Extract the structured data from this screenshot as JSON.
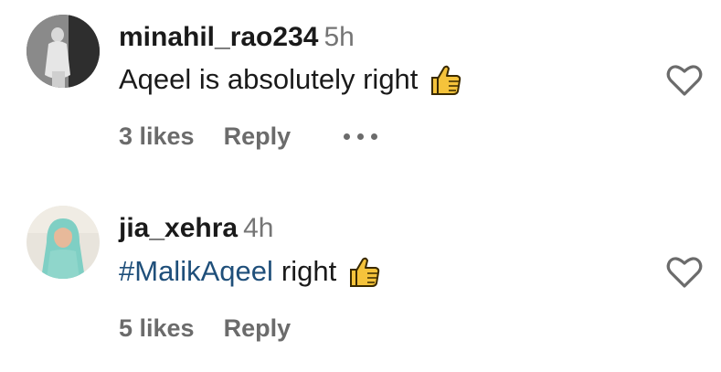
{
  "comments": [
    {
      "username": "minahil_rao234",
      "time": "5h",
      "text": "Aqeel is absolutely right",
      "hashtag": "",
      "emoji": "thumbs-up",
      "likes": "3 likes",
      "reply": "Reply",
      "avatar": "avatar-grayscale-photo",
      "more_icon": "more-horizontal-icon",
      "like_icon": "heart-outline-icon"
    },
    {
      "username": "jia_xehra",
      "time": "4h",
      "text": "right",
      "hashtag": "#MalikAqeel",
      "emoji": "thumbs-up",
      "likes": "5 likes",
      "reply": "Reply",
      "avatar": "avatar-teal-hijab-photo",
      "like_icon": "heart-outline-icon"
    }
  ],
  "colors": {
    "username": "#1a1a1a",
    "time": "#757575",
    "hashtag": "#1f4f7a",
    "actions": "#6b6b6b",
    "heart_stroke": "#6b6b6b"
  }
}
